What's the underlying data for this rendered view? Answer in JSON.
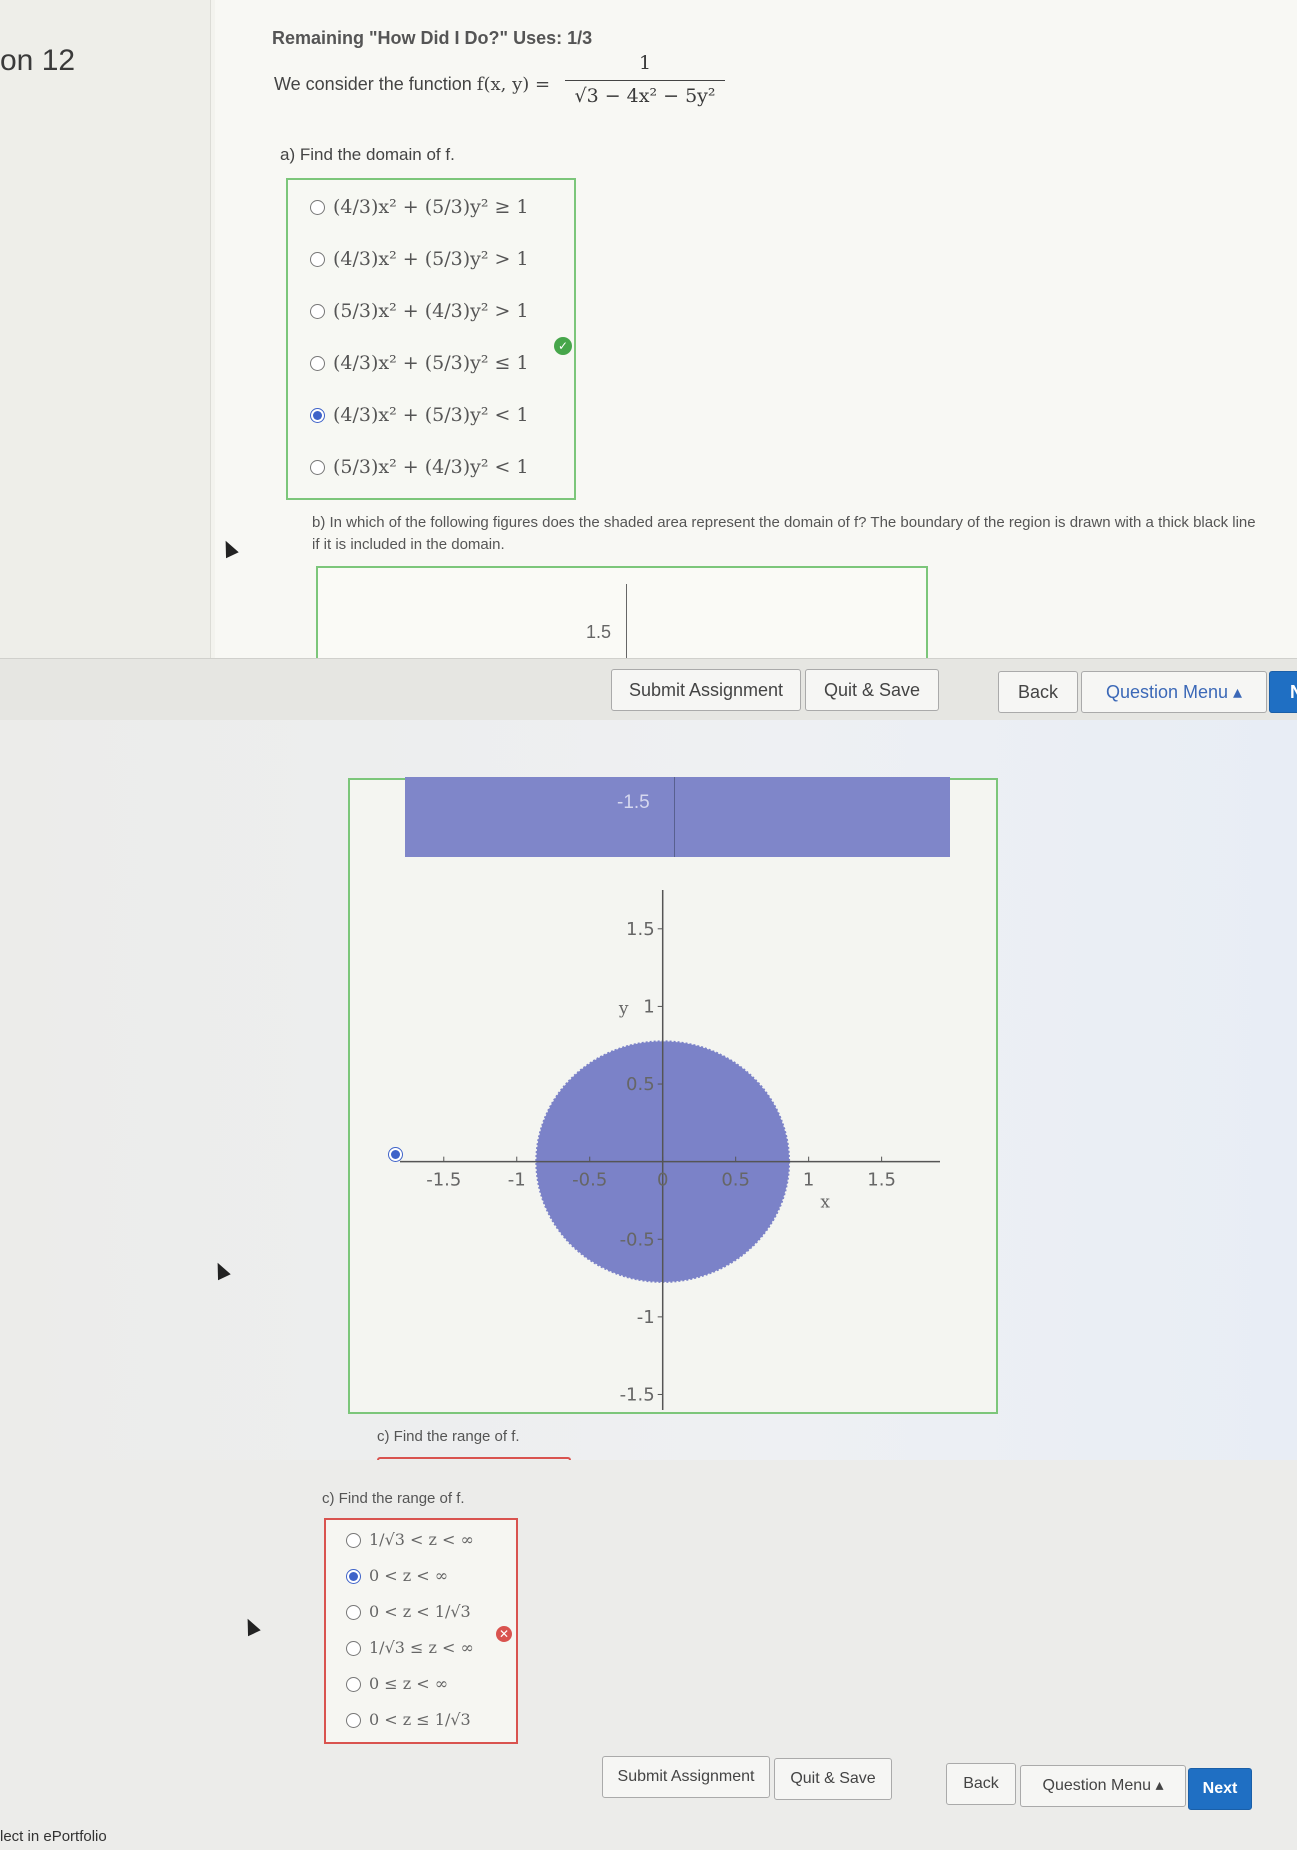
{
  "header": {
    "question_number": "on 12"
  },
  "remaining": "Remaining \"How Did I Do?\" Uses: 1/3",
  "function": {
    "lead": "We consider the function",
    "lhs": "f(x, y) =",
    "numerator": "1",
    "denominator": "√3 − 4x² − 5y²"
  },
  "part_a": {
    "prompt": "a) Find the domain of f.",
    "options": [
      "(4/3)x² + (5/3)y² ≥ 1",
      "(4/3)x² + (5/3)y² > 1",
      "(5/3)x² + (4/3)y² > 1",
      "(4/3)x² + (5/3)y² ≤ 1",
      "(4/3)x² + (5/3)y² < 1",
      "(5/3)x² + (4/3)y² < 1"
    ],
    "selected_index": 4,
    "status": "correct"
  },
  "part_b": {
    "prompt": "b) In which of the following figures does the shaded area represent the domain of f? The boundary of the region is drawn with a thick black line if it is included in the domain.",
    "top_tick": "1.5",
    "band_tick": "-1.5"
  },
  "chart_data": {
    "type": "area",
    "title": "",
    "xlabel": "x",
    "ylabel": "y",
    "xlim": [
      -1.8,
      1.9
    ],
    "ylim": [
      -1.6,
      1.75
    ],
    "x_ticks": [
      "-1.5",
      "-1",
      "-0.5",
      "0",
      "0.5",
      "1",
      "1.5"
    ],
    "y_ticks": [
      "1.5",
      "1",
      "0.5",
      "-0.5",
      "-1",
      "-1.5"
    ],
    "region": {
      "shape": "ellipse",
      "center": [
        0,
        0
      ],
      "rx": 0.866,
      "ry": 0.775,
      "boundary_included": false
    },
    "fill_color": "#7b82c8"
  },
  "part_c": {
    "prompt": "c) Find the range of f.",
    "options": [
      "1/√3 < z < ∞",
      "0 < z < ∞",
      "0 < z < 1/√3",
      "1/√3 ≤ z < ∞",
      "0 ≤ z < ∞",
      "0 < z ≤ 1/√3"
    ],
    "selected_index": 1,
    "status": "incorrect"
  },
  "toolbar": {
    "submit": "Submit Assignment",
    "quit_save": "Quit & Save",
    "back": "Back",
    "question_menu": "Question Menu ▴",
    "next": "Next",
    "next_partial": "N"
  },
  "footer": {
    "eportfolio": "lect in ePortfolio"
  },
  "colors": {
    "correct": "#46a64a",
    "incorrect": "#d9534f",
    "accent": "#1f6fc3",
    "region": "#7b82c8"
  }
}
